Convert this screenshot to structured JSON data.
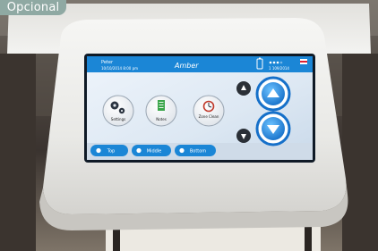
{
  "badge": "Opcional",
  "screen": {
    "status_line1": "Peter",
    "status_line2": "10/10/2014 8:00 pm",
    "brand": "Amber",
    "battery_text": "",
    "status_sub": "1 109/2014",
    "buttons": [
      {
        "label": "Settings",
        "icon": "gears-icon"
      },
      {
        "label": "Notes",
        "icon": "notepad-icon"
      },
      {
        "label": "Zone Clean",
        "icon": "timer-icon"
      }
    ],
    "bottom_tabs": [
      {
        "label": "Top"
      },
      {
        "label": "Middle"
      },
      {
        "label": "Bottom"
      }
    ],
    "arrows": [
      "up-arrow-button",
      "down-arrow-button"
    ]
  },
  "colors": {
    "badge": "#8fa9a3",
    "screen_blue": "#1b86d6",
    "arrow_blue": "#1e8fe6"
  }
}
